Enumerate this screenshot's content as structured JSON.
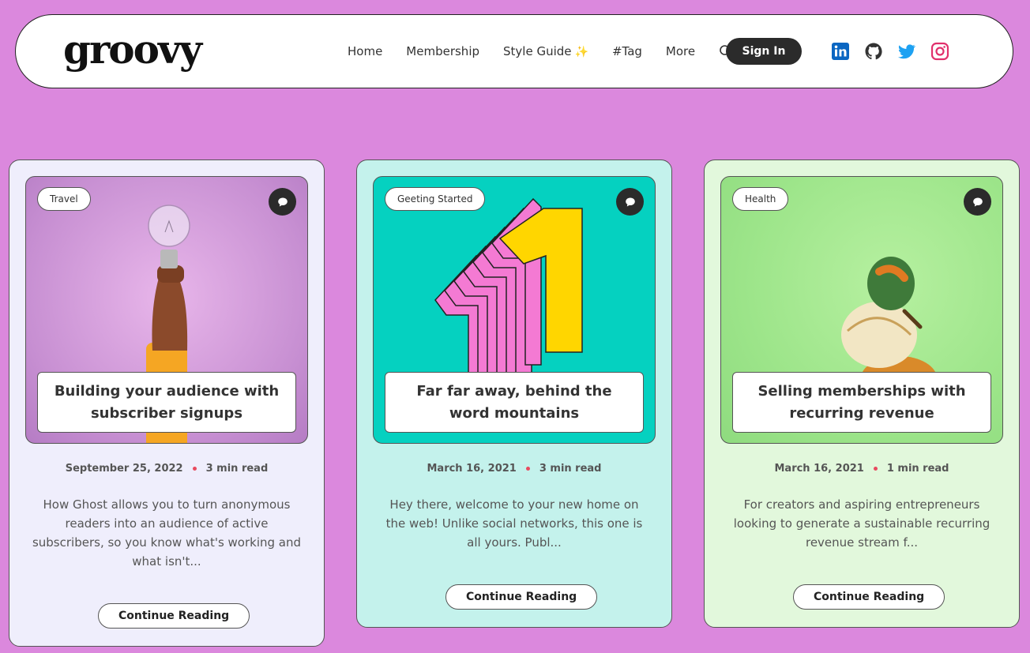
{
  "header": {
    "logo": "groovy",
    "nav": [
      "Home",
      "Membership",
      "Style Guide",
      "#Tag",
      "More"
    ],
    "style_guide_sparkle": "✨",
    "signin_label": "Sign In",
    "socials": [
      "linkedin-icon",
      "github-icon",
      "twitter-icon",
      "instagram-icon"
    ]
  },
  "colors": {
    "page_bg": "#db88dd",
    "linkedin": "#0a66c2",
    "twitter": "#1da1f2",
    "instagram": "#e1306c",
    "meta_dot": "#e84a5f"
  },
  "posts": [
    {
      "tag": "Travel",
      "title": "Building your audience with subscriber signups",
      "date": "September 25, 2022",
      "read_time": "3 min read",
      "excerpt": "How Ghost allows you to turn anonymous readers into an audience of active subscribers, so you know what's working and what isn't...",
      "button": "Continue Reading"
    },
    {
      "tag": "Geeting Started",
      "title": "Far far away, behind the word mountains",
      "date": "March 16, 2021",
      "read_time": "3 min read",
      "excerpt": "Hey there, welcome to your new home on the web! Unlike social networks, this one is all yours. Publ...",
      "button": "Continue Reading"
    },
    {
      "tag": "Health",
      "title": "Selling memberships with recurring revenue",
      "date": "March 16, 2021",
      "read_time": "1 min read",
      "excerpt": "For creators and aspiring entrepreneurs looking to generate a sustainable recurring revenue stream f...",
      "button": "Continue Reading"
    }
  ]
}
